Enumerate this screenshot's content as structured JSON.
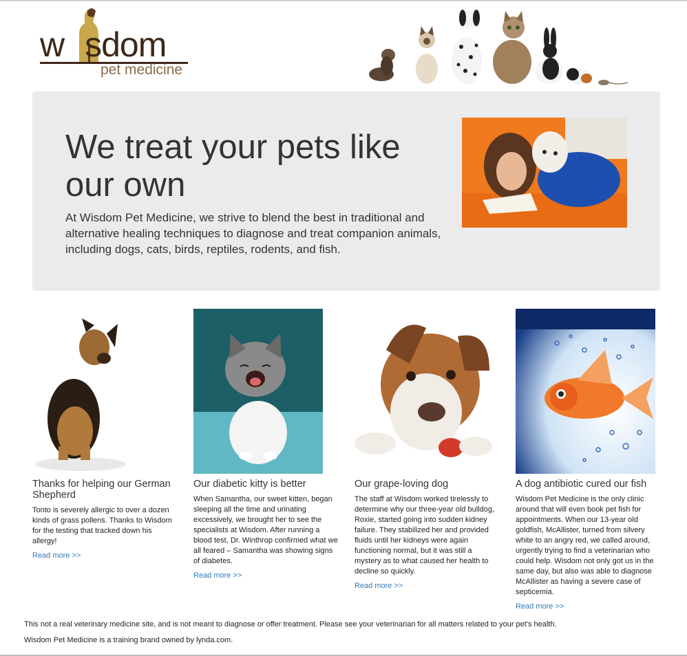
{
  "logo": {
    "word_start": "w",
    "word_end": "sdom",
    "tagline": "pet medicine"
  },
  "hero": {
    "title": "We treat your pets like our own",
    "text": "At Wisdom Pet Medicine, we strive to blend the best in traditional and alternative healing techniques to diagnose and treat companion animals, including dogs, cats, birds, reptiles, rodents, and fish."
  },
  "cards": [
    {
      "title": "Thanks for helping our German Shepherd",
      "text": "Tonto is severely allergic to over a dozen kinds of grass pollens. Thanks to Wisdom for the testing that tracked down his allergy!",
      "link": "Read more >>"
    },
    {
      "title": "Our diabetic kitty is better",
      "text": "When Samantha, our sweet kitten, began sleeping all the time and urinating excessively, we brought her to see the specialists at Wisdom. After running a blood test, Dr. Winthrop confirmed what we all feared – Samantha was showing signs of diabetes.",
      "link": "Read more >>"
    },
    {
      "title": "Our grape-loving dog",
      "text": "The staff at Wisdom worked tirelessly to determine why our three-year old bulldog, Roxie, started going into sudden kidney failure. They stabilized her and provided fluids until her kidneys were again functioning normal, but it was still a mystery as to what caused her health to decline so quickly.",
      "link": "Read more >>"
    },
    {
      "title": "A dog antibiotic cured our fish",
      "text": "Wisdom Pet Medicine is the only clinic around that will even book pet fish for appointments. When our 13-year old goldfish, McAllister, turned from silvery white to an angry red, we called around, urgently trying to find a veterinarian who could help. Wisdom not only got us in the same day, but also was able to diagnose McAllister as having a severe case of septicemia.",
      "link": "Read more >>"
    }
  ],
  "footer": {
    "disclaimer": "This not a real veterinary medicine site, and is not meant to diagnose or offer treatment. Please see your veterinarian for all matters related to your pet's health.",
    "brand": "Wisdom Pet Medicine is a training brand owned by lynda.com."
  },
  "colors": {
    "hero_bg": "#ebebeb",
    "link": "#337ab7",
    "logo_brown": "#3d2718",
    "logo_gold": "#c9a84c"
  }
}
